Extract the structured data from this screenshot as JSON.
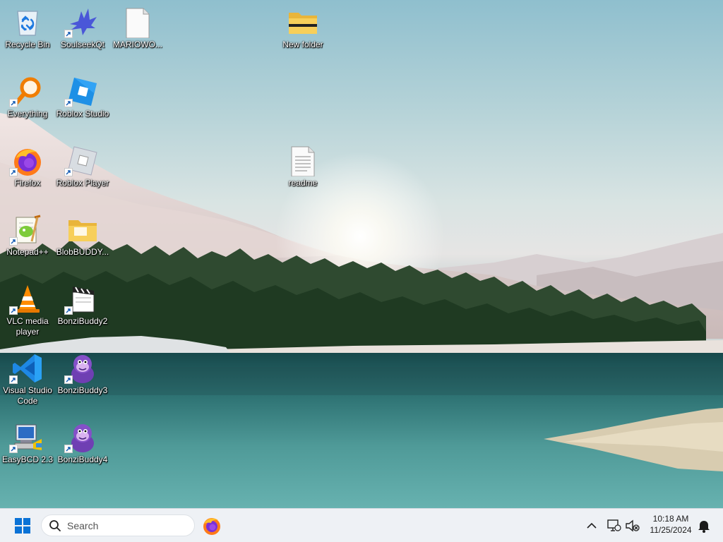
{
  "desktop": {
    "icons": [
      {
        "label": "Recycle Bin",
        "icon": "recycle-bin-icon",
        "shortcut": false
      },
      {
        "label": "SoulseekQt",
        "icon": "soulseek-bird-icon",
        "shortcut": true
      },
      {
        "label": "MARIOWO...",
        "icon": "blank-file-icon",
        "shortcut": false
      },
      {
        "label": "New folder",
        "icon": "folder-icon",
        "shortcut": false
      },
      {
        "label": "Everything",
        "icon": "magnifier-icon",
        "shortcut": true
      },
      {
        "label": "Roblox Studio",
        "icon": "roblox-studio-icon",
        "shortcut": true
      },
      {
        "label": "Firefox",
        "icon": "firefox-icon",
        "shortcut": true
      },
      {
        "label": "Roblox Player",
        "icon": "roblox-player-icon",
        "shortcut": true
      },
      {
        "label": "readme",
        "icon": "text-file-icon",
        "shortcut": false
      },
      {
        "label": "Notepad++",
        "icon": "notepad-plus-plus-icon",
        "shortcut": true
      },
      {
        "label": "BlobBUDDY...",
        "icon": "folder-icon",
        "shortcut": false
      },
      {
        "label": "VLC media player",
        "icon": "vlc-cone-icon",
        "shortcut": true
      },
      {
        "label": "BonziBuddy2",
        "icon": "bonzibuddy-clapper-icon",
        "shortcut": true
      },
      {
        "label": "Visual Studio Code",
        "icon": "vscode-icon",
        "shortcut": true
      },
      {
        "label": "BonziBuddy3",
        "icon": "bonzi-gorilla-icon",
        "shortcut": true
      },
      {
        "label": "EasyBCD 2.3",
        "icon": "easybcd-icon",
        "shortcut": true
      },
      {
        "label": "BonziBuddy4",
        "icon": "bonzi-gorilla-icon",
        "shortcut": true
      }
    ]
  },
  "taskbar": {
    "start_icon": "windows-logo-icon",
    "search_placeholder": "Search",
    "pinned": [
      {
        "name": "Firefox",
        "icon": "firefox-icon"
      }
    ],
    "tray_icons": [
      "chevron-up-icon",
      "network-icon",
      "volume-muted-icon"
    ],
    "clock": {
      "time": "10:18 AM",
      "date": "11/25/2024"
    },
    "notification_icon": "bell-icon"
  },
  "colors": {
    "taskbar_bg": "#eef1f5",
    "windows_blue": "#0a72d6",
    "folder_yellow": "#f4c64a",
    "lake": "#1f6f72"
  }
}
